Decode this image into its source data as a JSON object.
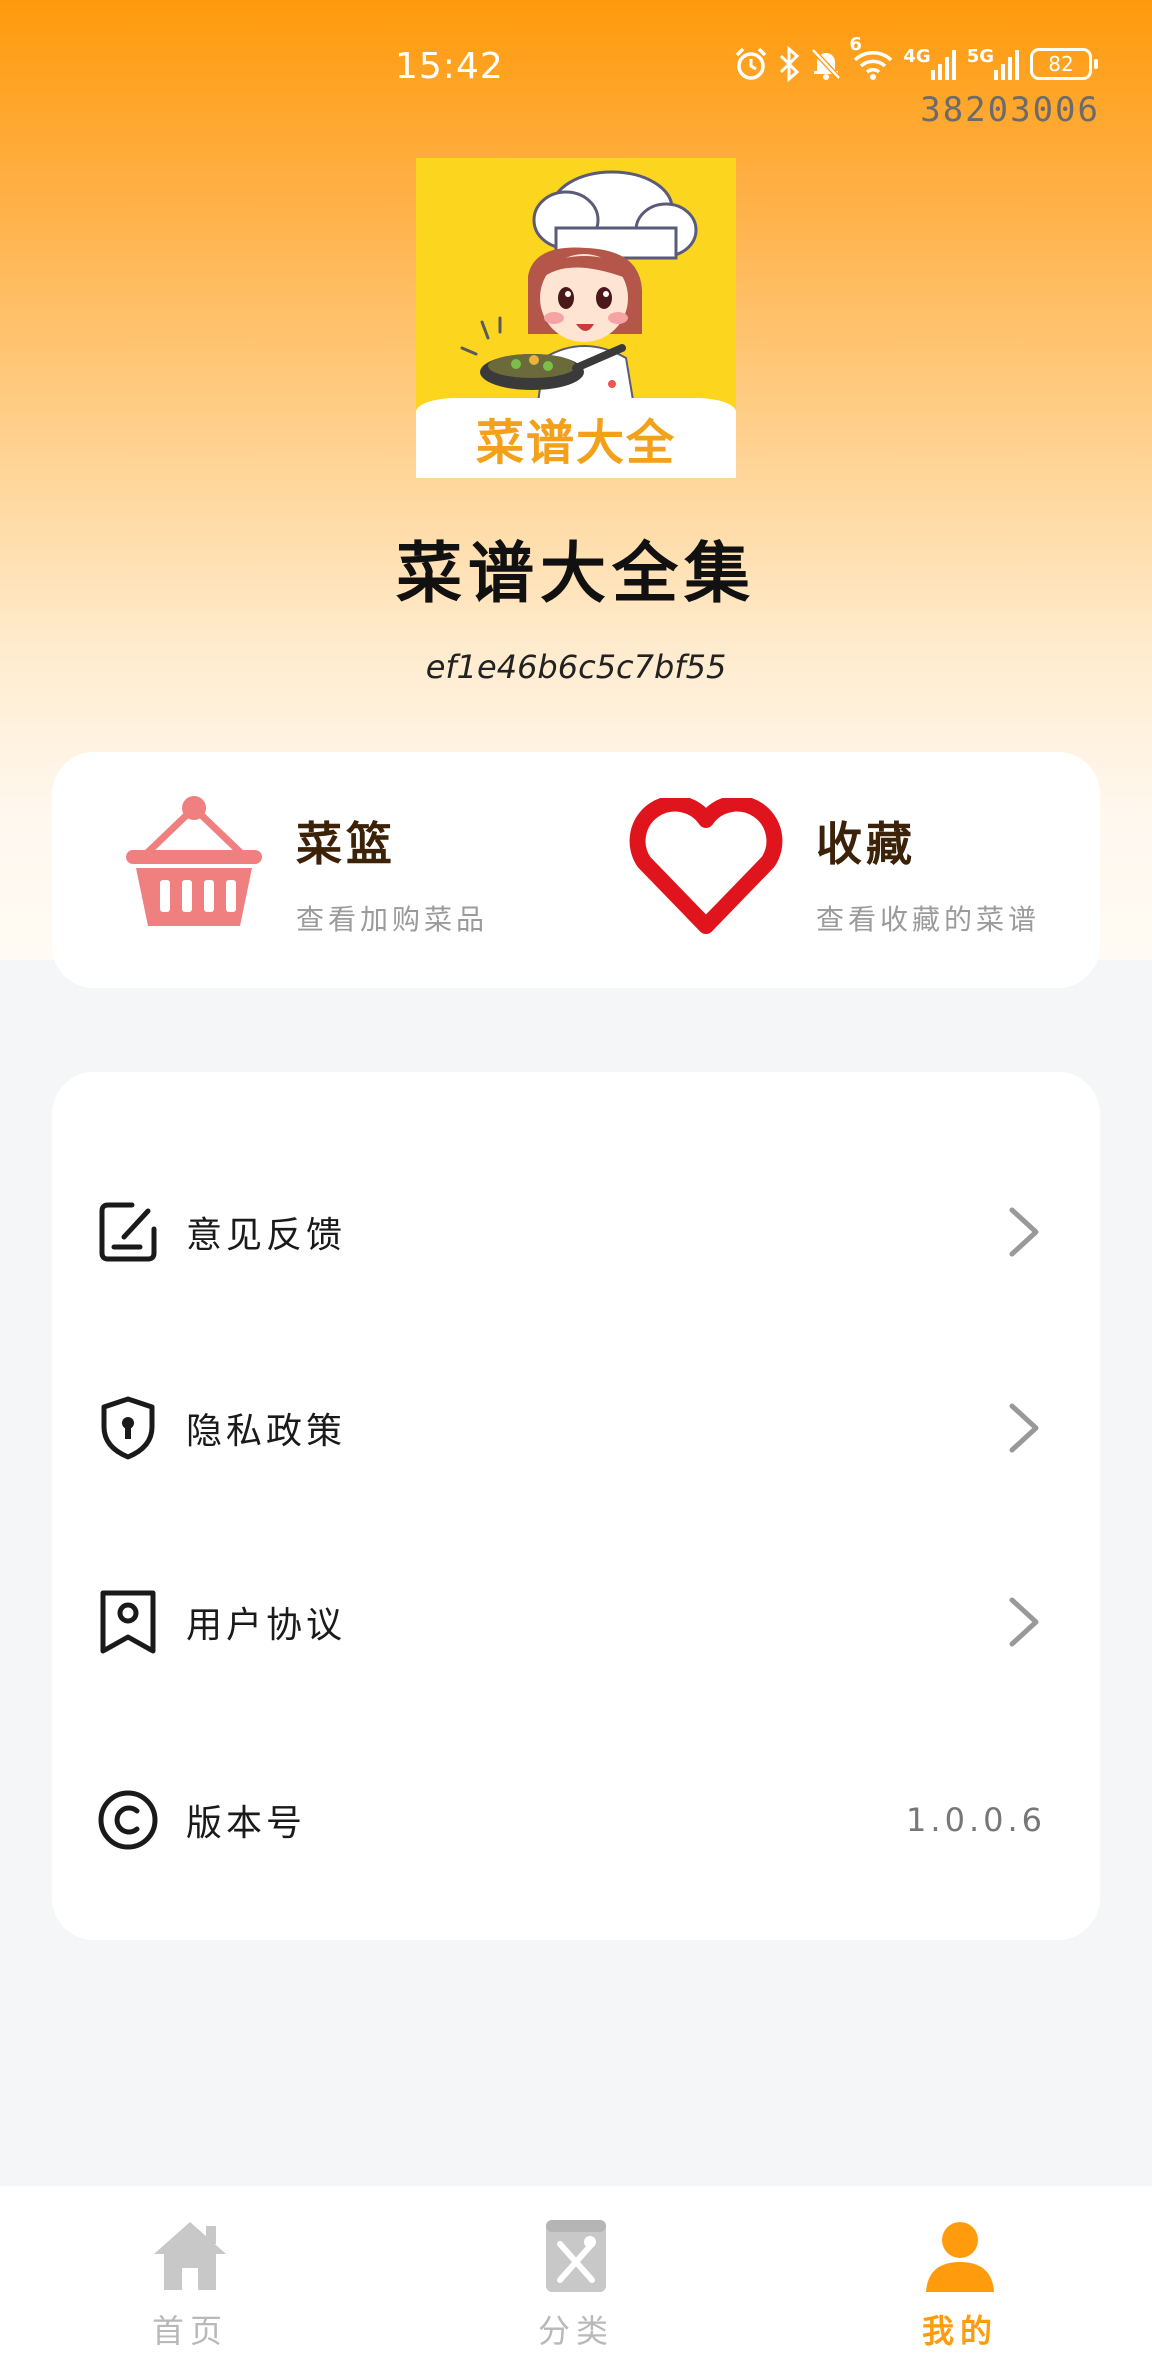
{
  "status_bar": {
    "time": "15:42",
    "battery": "82",
    "signal_4g_label": "4G",
    "signal_5g_label": "5G",
    "wifi_label": "6",
    "counter": "38203006"
  },
  "profile": {
    "logo_text": "菜谱大全",
    "app_name": "菜谱大全集",
    "device_id": "ef1e46b6c5c7bf55"
  },
  "quick": {
    "basket": {
      "title": "菜篮",
      "subtitle": "查看加购菜品"
    },
    "favorites": {
      "title": "收藏",
      "subtitle": "查看收藏的菜谱"
    }
  },
  "menu": {
    "feedback_label": "意见反馈",
    "privacy_label": "隐私政策",
    "agreement_label": "用户协议",
    "version_label": "版本号",
    "version_value": "1.0.0.6"
  },
  "nav": {
    "home_label": "首页",
    "category_label": "分类",
    "mine_label": "我的"
  },
  "colors": {
    "accent": "#ff9b0d",
    "basket_icon": "#f08080",
    "heart_icon": "#e0141c",
    "title_brown": "#3b2208"
  }
}
